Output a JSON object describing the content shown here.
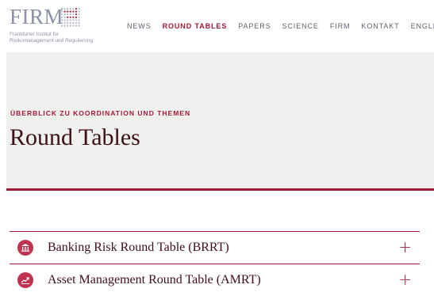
{
  "brand": {
    "wordmark": "FIRM",
    "subtitle_line1": "Frankfurter Institut für",
    "subtitle_line2": "Risikomanagement und Regulierung"
  },
  "nav": {
    "items": [
      {
        "label": "NEWS",
        "active": false
      },
      {
        "label": "ROUND TABLES",
        "active": true
      },
      {
        "label": "PAPERS",
        "active": false
      },
      {
        "label": "SCIENCE",
        "active": false
      },
      {
        "label": "FIRM",
        "active": false
      },
      {
        "label": "KONTAKT",
        "active": false
      },
      {
        "label": "ENGLISH",
        "active": false
      }
    ]
  },
  "hero": {
    "eyebrow": "ÜBERBLICK ZU KOORDINATION UND THEMEN",
    "title": "Round Tables"
  },
  "accordion": {
    "items": [
      {
        "label": "Banking Risk Round Table (BRRT)",
        "icon": "bank-icon",
        "toggle": "+"
      },
      {
        "label": "Asset Management Round Table (AMRT)",
        "icon": "chart-trend-icon",
        "toggle": "+"
      }
    ]
  },
  "colors": {
    "accent": "#a31a38",
    "title": "#3d0f1a",
    "hero_bg": "#f0f0ee",
    "icon_bg": "#c2334f",
    "logo_grey": "#8b92a5"
  }
}
